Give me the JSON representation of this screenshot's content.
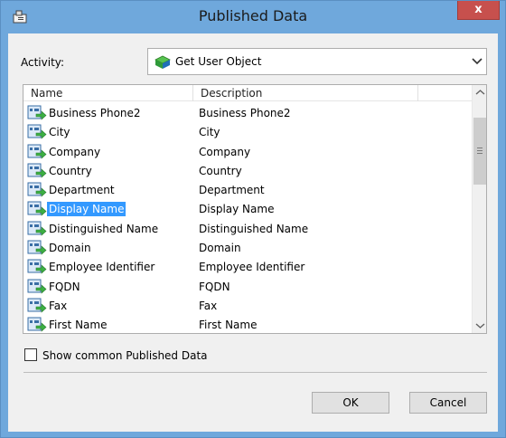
{
  "window": {
    "title": "Published Data",
    "close_label": "x"
  },
  "activity": {
    "label": "Activity:",
    "value": "Get User Object"
  },
  "list": {
    "columns": [
      "Name",
      "Description"
    ],
    "rows": [
      {
        "name": "Business Phone2",
        "description": "Business Phone2"
      },
      {
        "name": "City",
        "description": "City"
      },
      {
        "name": "Company",
        "description": "Company"
      },
      {
        "name": "Country",
        "description": "Country"
      },
      {
        "name": "Department",
        "description": "Department"
      },
      {
        "name": "Display Name",
        "description": "Display Name",
        "selected": true
      },
      {
        "name": "Distinguished Name",
        "description": "Distinguished Name"
      },
      {
        "name": "Domain",
        "description": "Domain"
      },
      {
        "name": "Employee Identifier",
        "description": "Employee Identifier"
      },
      {
        "name": "FQDN",
        "description": "FQDN"
      },
      {
        "name": "Fax",
        "description": "Fax"
      },
      {
        "name": "First Name",
        "description": "First Name"
      }
    ]
  },
  "checkbox": {
    "label": "Show common Published Data",
    "checked": false
  },
  "buttons": {
    "ok": "OK",
    "cancel": "Cancel"
  },
  "colors": {
    "titlebar": "#6fa8dc",
    "selection": "#3399ff",
    "close": "#c7504d"
  }
}
